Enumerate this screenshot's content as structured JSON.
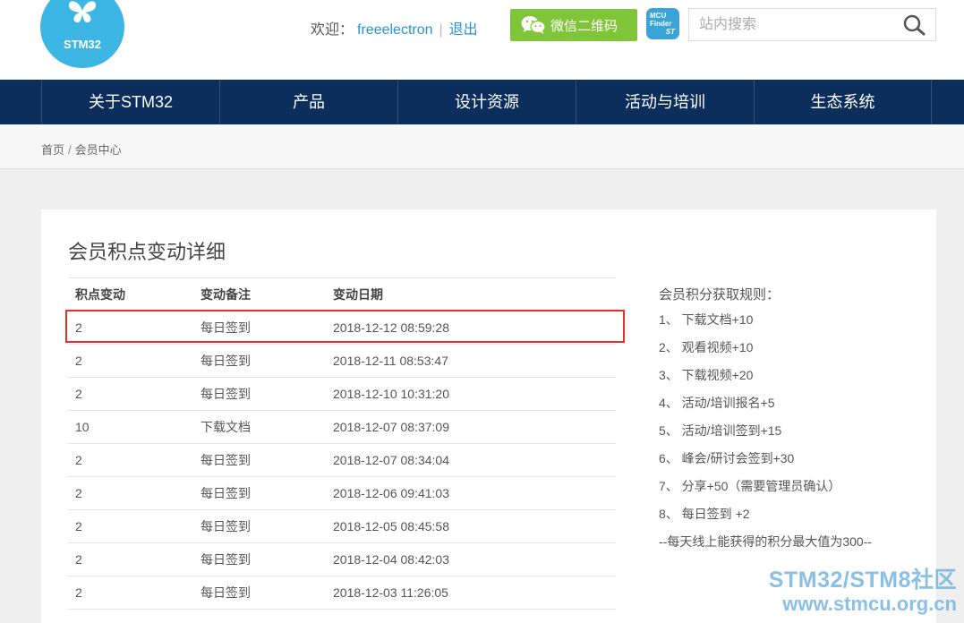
{
  "header": {
    "logo_text": "STM32",
    "welcome_label": "欢迎：",
    "username": "freeelectron",
    "separator": "|",
    "logout_label": "退出",
    "wechat_label": "微信二维码",
    "mcu_finder_line1": "MCU",
    "mcu_finder_line2": "Finder",
    "mcu_finder_brand": "ST",
    "search_placeholder": "站内搜索",
    "search_icon": "search-icon"
  },
  "colors": {
    "nav_bg": "#0c2e5c",
    "logo_bg": "#3db6e3",
    "wechat_green": "#80c43a",
    "link_blue": "#2a93d0",
    "highlight_red": "#e2322a"
  },
  "nav": {
    "items": [
      {
        "label": "关于STM32"
      },
      {
        "label": "产品"
      },
      {
        "label": "设计资源"
      },
      {
        "label": "活动与培训"
      },
      {
        "label": "生态系统"
      }
    ]
  },
  "breadcrumb": {
    "home": "首页",
    "divider": "/",
    "current": "会员中心"
  },
  "main": {
    "title": "会员积点变动详细",
    "table": {
      "headers": [
        "积点变动",
        "变动备注",
        "变动日期"
      ],
      "rows": [
        {
          "points": "2",
          "note": "每日签到",
          "date": "2018-12-12 08:59:28"
        },
        {
          "points": "2",
          "note": "每日签到",
          "date": "2018-12-11 08:53:47"
        },
        {
          "points": "2",
          "note": "每日签到",
          "date": "2018-12-10 10:31:20"
        },
        {
          "points": "10",
          "note": "下载文档",
          "date": "2018-12-07 08:37:09"
        },
        {
          "points": "2",
          "note": "每日签到",
          "date": "2018-12-07 08:34:04"
        },
        {
          "points": "2",
          "note": "每日签到",
          "date": "2018-12-06 09:41:03"
        },
        {
          "points": "2",
          "note": "每日签到",
          "date": "2018-12-05 08:45:58"
        },
        {
          "points": "2",
          "note": "每日签到",
          "date": "2018-12-04 08:42:03"
        },
        {
          "points": "2",
          "note": "每日签到",
          "date": "2018-12-03 11:26:05"
        }
      ]
    },
    "rules": {
      "title": "会员积分获取规则：",
      "items": [
        "1、 下载文档+10",
        "2、 观看视频+10",
        "3、 下载视频+20",
        "4、 活动/培训报名+5",
        "5、 活动/培训签到+15",
        "6、 峰会/研讨会签到+30",
        "7、 分享+50（需要管理员确认）",
        "8、 每日签到 +2"
      ],
      "note": "--每天线上能获得的积分最大值为300--"
    }
  },
  "watermark": {
    "line1": "STM32/STM8社区",
    "line2": "www.stmcu.org.cn"
  }
}
